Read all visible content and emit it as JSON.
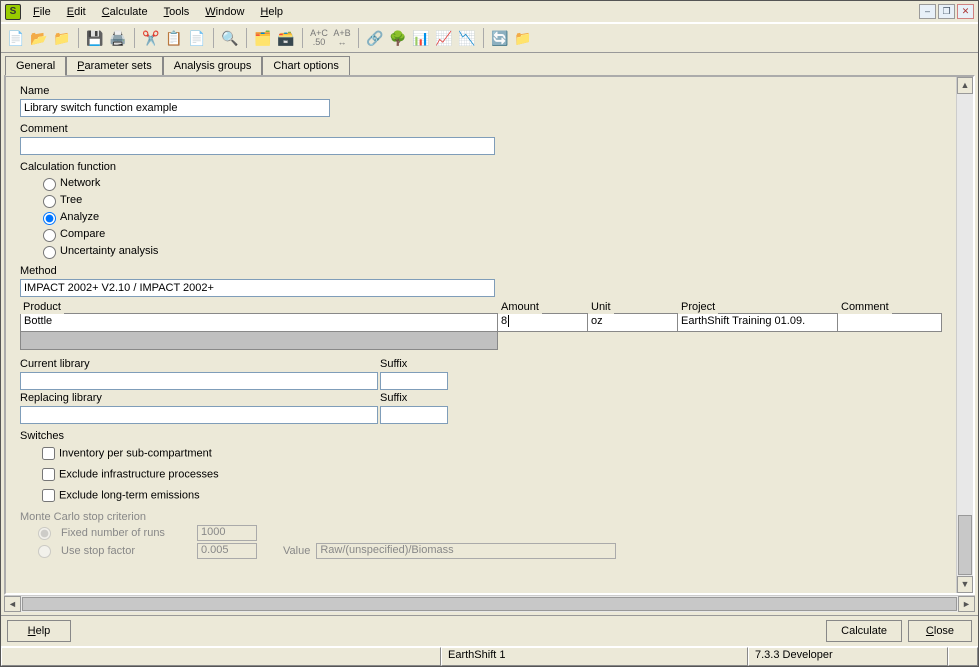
{
  "menu": {
    "file": "File",
    "edit": "Edit",
    "calculate": "Calculate",
    "tools": "Tools",
    "window": "Window",
    "help": "Help"
  },
  "tabs": {
    "general": "General",
    "params": "Parameter sets",
    "analysis": "Analysis groups",
    "chart": "Chart options"
  },
  "labels": {
    "name": "Name",
    "comment": "Comment",
    "calcFunc": "Calculation function",
    "network": "Network",
    "tree": "Tree",
    "analyze": "Analyze",
    "compare": "Compare",
    "uncertainty": "Uncertainty analysis",
    "method": "Method",
    "product": "Product",
    "amount": "Amount",
    "unit": "Unit",
    "project": "Project",
    "colComment": "Comment",
    "currentLib": "Current library",
    "suffix": "Suffix",
    "replacingLib": "Replacing library",
    "switches": "Switches",
    "invPerSub": "Inventory per sub-compartment",
    "exclInfra": "Exclude infrastructure processes",
    "exclLong": "Exclude long-term emissions",
    "mcStop": "Monte Carlo stop criterion",
    "fixedRuns": "Fixed number of runs",
    "useStop": "Use stop factor",
    "value": "Value"
  },
  "fields": {
    "name": "Library switch function example",
    "comment": "",
    "method": "IMPACT 2002+ V2.10 / IMPACT 2002+",
    "product": "Bottle",
    "amount": "8",
    "unit": "oz",
    "project": "EarthShift Training 01.09.",
    "prodComment": "",
    "currentLib": "",
    "currentSuffix": "",
    "replacingLib": "",
    "replacingSuffix": "",
    "fixedRuns": "1000",
    "stopFactor": "0.005",
    "stopValue": "Raw/(unspecified)/Biomass"
  },
  "buttons": {
    "help": "Help",
    "calculate": "Calculate",
    "close": "Close"
  },
  "status": {
    "center": "EarthShift 1",
    "right": "7.3.3 Developer"
  }
}
